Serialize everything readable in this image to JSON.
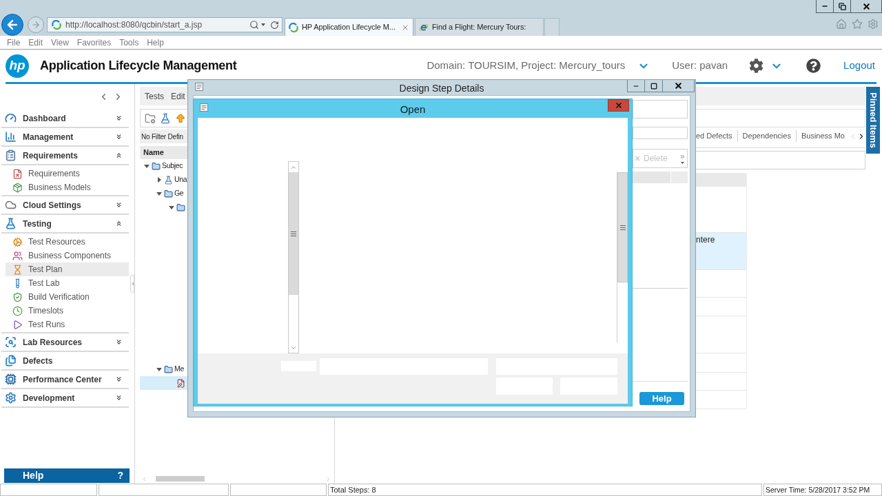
{
  "browser": {
    "address": "http://localhost:8080/qcbin/start_a.jsp",
    "tabs": [
      {
        "title": "HP Application Lifecycle M...",
        "selected": true,
        "kind": "alm"
      },
      {
        "title": "Find a Flight: Mercury Tours:",
        "selected": false,
        "kind": "ie"
      }
    ],
    "menu": [
      "File",
      "Edit",
      "View",
      "Favorites",
      "Tools",
      "Help"
    ]
  },
  "header": {
    "logo": "hp",
    "title": "Application Lifecycle Management",
    "context": "Domain: TOURSIM, Project: Mercury_tours",
    "user": "User: pavan",
    "logout": "Logout"
  },
  "sidebar": {
    "sections": [
      {
        "label": "Dashboard",
        "kind": "group",
        "expanded": false
      },
      {
        "label": "Management",
        "kind": "group",
        "expanded": false
      },
      {
        "label": "Requirements",
        "kind": "group",
        "expanded": true,
        "items": [
          {
            "label": "Requirements",
            "selected": false
          },
          {
            "label": "Business Models",
            "selected": false
          }
        ]
      },
      {
        "label": "Cloud Settings",
        "kind": "group",
        "expanded": false
      },
      {
        "label": "Testing",
        "kind": "group",
        "expanded": true,
        "items": [
          {
            "label": "Test Resources",
            "selected": false
          },
          {
            "label": "Business Components",
            "selected": false
          },
          {
            "label": "Test Plan",
            "selected": true
          },
          {
            "label": "Test Lab",
            "selected": false
          },
          {
            "label": "Build Verification",
            "selected": false
          },
          {
            "label": "Timeslots",
            "selected": false
          },
          {
            "label": "Test Runs",
            "selected": false
          }
        ]
      },
      {
        "label": "Lab Resources",
        "kind": "group",
        "expanded": false
      },
      {
        "label": "Defects",
        "kind": "link"
      },
      {
        "label": "Performance Center",
        "kind": "group",
        "expanded": false
      },
      {
        "label": "Development",
        "kind": "group",
        "expanded": false
      }
    ],
    "help": {
      "label": "Help",
      "mark": "?"
    }
  },
  "tree_panel": {
    "menu": [
      "Tests",
      "Edit"
    ],
    "filter": "No Filter Defin",
    "column": "Name",
    "tree": [
      {
        "kind": "folder",
        "label": "Subjec",
        "expanded": true,
        "selected": false,
        "children": [
          {
            "kind": "flask",
            "label": "Una",
            "expanded": false,
            "selected": false
          },
          {
            "kind": "folder",
            "label": "Ge",
            "expanded": true,
            "selected": false,
            "children": [
              {
                "kind": "folder",
                "expanded": true,
                "selected": false
              }
            ]
          },
          {
            "kind": "folder",
            "label": "Me",
            "expanded": true,
            "selected": false,
            "children": [
              {
                "kind": "test",
                "selected": true
              }
            ]
          }
        ]
      }
    ]
  },
  "details": {
    "tabs": [
      "ed Defects",
      "Dependencies",
      "Business Mo"
    ],
    "grid_rows": [
      {
        "selected": false
      },
      {
        "text": "ntere",
        "selected": true
      },
      {
        "selected": false
      },
      {
        "selected": false
      },
      {
        "selected": false
      },
      {
        "selected": false
      },
      {
        "selected": false
      },
      {
        "selected": false
      }
    ]
  },
  "pinned": "Pinned Items",
  "design_step_dialog": {
    "title": "Design Step Details",
    "delete": {
      "label": "Delete",
      "disabled": true
    },
    "help": "Help"
  },
  "open_dialog": {
    "title": "Open"
  },
  "status_bar": {
    "total_steps": "Total Steps: 8",
    "server_time": "Server Time: 5/28/2017 3:52 PM"
  }
}
